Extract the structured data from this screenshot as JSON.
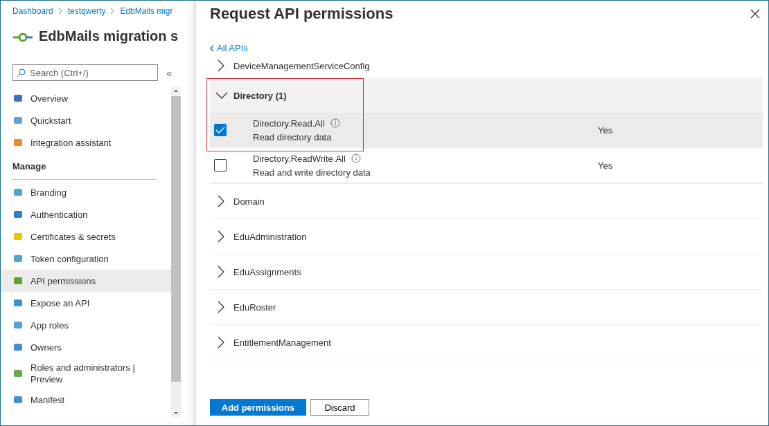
{
  "breadcrumb": [
    "Dashboard",
    "testqwerty",
    "EdbMails migr"
  ],
  "app_title": "EdbMails migration s",
  "search": {
    "placeholder": "Search (Ctrl+/)"
  },
  "collapse_button": "«",
  "nav": [
    {
      "kind": "item",
      "label": "Overview",
      "selected": false
    },
    {
      "kind": "item",
      "label": "Quickstart",
      "selected": false
    },
    {
      "kind": "item",
      "label": "Integration assistant",
      "selected": false
    },
    {
      "kind": "header",
      "label": "Manage"
    },
    {
      "kind": "item",
      "label": "Branding",
      "selected": false
    },
    {
      "kind": "item",
      "label": "Authentication",
      "selected": false
    },
    {
      "kind": "item",
      "label": "Certificates & secrets",
      "selected": false
    },
    {
      "kind": "item",
      "label": "Token configuration",
      "selected": false
    },
    {
      "kind": "item",
      "label": "API permissions",
      "selected": true
    },
    {
      "kind": "item",
      "label": "Expose an API",
      "selected": false
    },
    {
      "kind": "item",
      "label": "App roles",
      "selected": false
    },
    {
      "kind": "item",
      "label": "Owners",
      "selected": false
    },
    {
      "kind": "item",
      "label": "Roles and administrators | Preview",
      "selected": false
    },
    {
      "kind": "item",
      "label": "Manifest",
      "selected": false
    }
  ],
  "panel": {
    "title": "Request API permissions",
    "back_link": "All APIs",
    "groups": [
      {
        "name": "DeviceManagementServiceConfig",
        "expanded": false
      },
      {
        "name": "Directory (1)",
        "expanded": true,
        "permissions": [
          {
            "name": "Directory.Read.All",
            "description": "Read directory data",
            "admin_consent": "Yes",
            "checked": true
          },
          {
            "name": "Directory.ReadWrite.All",
            "description": "Read and write directory data",
            "admin_consent": "Yes",
            "checked": false
          }
        ]
      },
      {
        "name": "Domain",
        "expanded": false
      },
      {
        "name": "EduAdministration",
        "expanded": false
      },
      {
        "name": "EduAssignments",
        "expanded": false
      },
      {
        "name": "EduRoster",
        "expanded": false
      },
      {
        "name": "EntitlementManagement",
        "expanded": false
      }
    ],
    "buttons": {
      "primary": "Add permissions",
      "secondary": "Discard"
    }
  }
}
